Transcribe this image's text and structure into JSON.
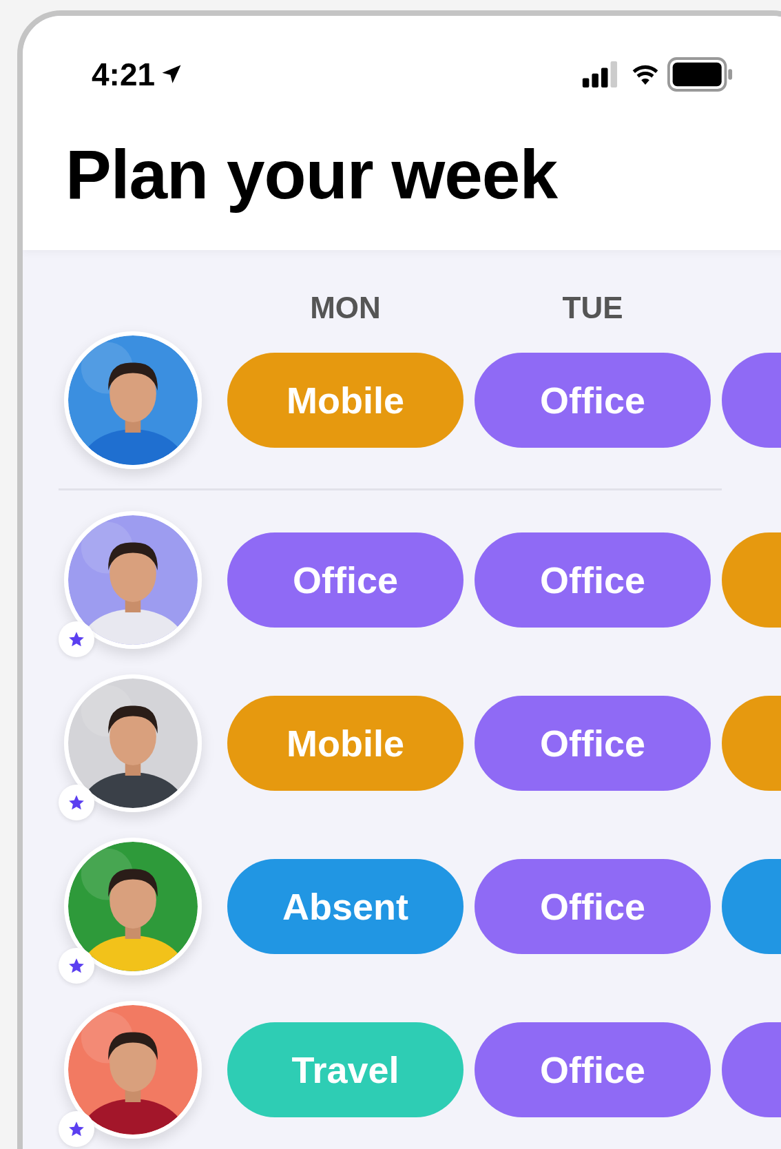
{
  "status_bar": {
    "time": "4:21"
  },
  "title": "Plan your week",
  "days": [
    "MON",
    "TUE"
  ],
  "people": [
    {
      "starred": false,
      "pills": [
        {
          "label": "Mobile",
          "color": "#e6990f"
        },
        {
          "label": "Office",
          "color": "#8f6af5"
        },
        {
          "color": "#8f6af5"
        }
      ]
    },
    {
      "starred": true,
      "pills": [
        {
          "label": "Office",
          "color": "#8f6af5"
        },
        {
          "label": "Office",
          "color": "#8f6af5"
        },
        {
          "color": "#e6990f"
        }
      ]
    },
    {
      "starred": true,
      "pills": [
        {
          "label": "Mobile",
          "color": "#e6990f"
        },
        {
          "label": "Office",
          "color": "#8f6af5"
        },
        {
          "color": "#e6990f"
        }
      ]
    },
    {
      "starred": true,
      "pills": [
        {
          "label": "Absent",
          "color": "#2196e3"
        },
        {
          "label": "Office",
          "color": "#8f6af5"
        },
        {
          "color": "#2196e3"
        }
      ]
    },
    {
      "starred": true,
      "pills": [
        {
          "label": "Travel",
          "color": "#2ecdb4"
        },
        {
          "label": "Office",
          "color": "#8f6af5"
        },
        {
          "color": "#8f6af5"
        }
      ]
    }
  ]
}
